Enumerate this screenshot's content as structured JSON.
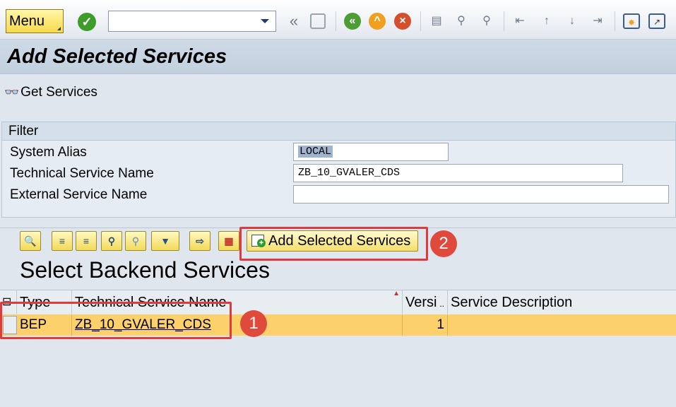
{
  "toolbar": {
    "menu_label": "Menu",
    "command_value": "",
    "icons": [
      "ok-icon",
      "back-double-icon",
      "save-icon",
      "back-icon",
      "exit-icon",
      "cancel-icon",
      "print-icon",
      "find-icon",
      "find-next-icon",
      "first-page-icon",
      "previous-page-icon",
      "next-page-icon",
      "last-page-icon",
      "new-session-icon",
      "shortcut-icon"
    ]
  },
  "page": {
    "title": "Add Selected Services",
    "get_services_label": "Get Services"
  },
  "filter": {
    "title": "Filter",
    "fields": [
      {
        "label": "System Alias",
        "value": "LOCAL"
      },
      {
        "label": "Technical Service Name",
        "value": "ZB_10_GVALER_CDS"
      },
      {
        "label": "External Service Name",
        "value": ""
      }
    ]
  },
  "alv": {
    "add_button_label": "Add Selected Services",
    "section_title": "Select Backend Services",
    "columns": [
      "Type",
      "Technical Service Name",
      "Versi",
      "Service Description"
    ],
    "rows": [
      {
        "type": "BEP",
        "technical_name": "ZB_10_GVALER_CDS",
        "version": "1",
        "description": ""
      }
    ]
  },
  "annotations": {
    "badge_1": "1",
    "badge_2": "2",
    "highlight_color": "#e0393e"
  },
  "colors": {
    "selected_row": "#fcd16c",
    "button_yellow": "#f3de6a",
    "title_bar": "#c2d0de"
  }
}
